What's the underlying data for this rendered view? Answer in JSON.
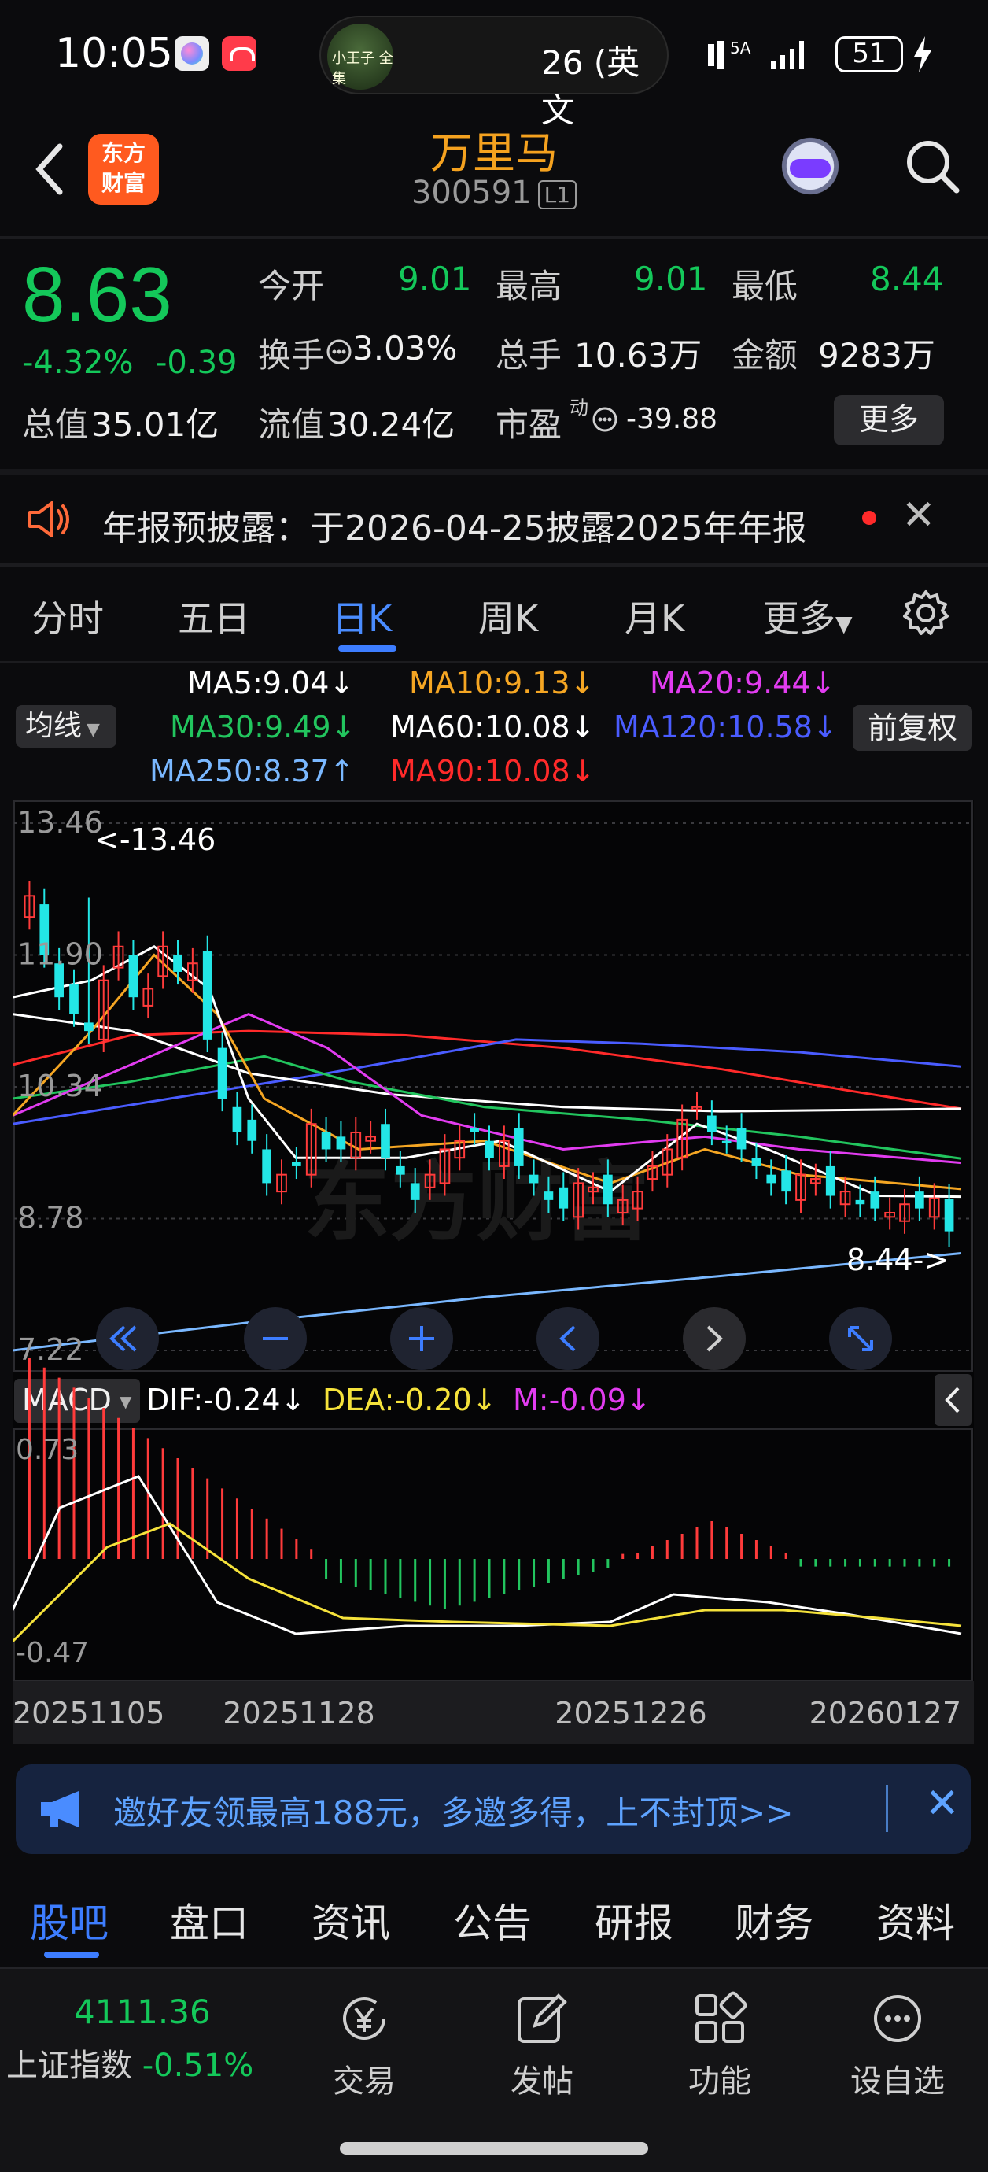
{
  "status_bar": {
    "time": "10:05",
    "island_text": "26 (英文",
    "island_thumb": "小王子 全集",
    "signal": "5A",
    "battery": "51"
  },
  "header": {
    "name": "万里马",
    "code": "300591",
    "badge": "L1",
    "logo": "东方\n财富"
  },
  "quote": {
    "price": "8.63",
    "change_pct": "-4.32%",
    "change": "-0.39",
    "open_label": "今开",
    "open": "9.01",
    "high_label": "最高",
    "high": "9.01",
    "low_label": "最低",
    "low": "8.44",
    "turnover_label": "换手",
    "turnover": "3.03%",
    "volume_label": "总手",
    "volume": "10.63万",
    "amount_label": "金额",
    "amount": "9283万",
    "mktcap_label": "总值",
    "mktcap": "35.01亿",
    "float_label": "流值",
    "float": "30.24亿",
    "pe_label": "市盈",
    "pe_sup": "动",
    "pe": "-39.88",
    "more": "更多"
  },
  "notice": {
    "text": "年报预披露：于2026-04-25披露2025年年报"
  },
  "chart_tabs": [
    "分时",
    "五日",
    "日K",
    "周K",
    "月K",
    "更多"
  ],
  "ma_legend": {
    "selector": "均线",
    "ma5": "MA5:9.04↓",
    "ma10": "MA10:9.13↓",
    "ma20": "MA20:9.44↓",
    "ma30": "MA30:9.49↓",
    "ma60": "MA60:10.08↓",
    "ma120": "MA120:10.58↓",
    "ma250": "MA250:8.37↑",
    "ma90": "MA90:10.08↓",
    "adjust": "前复权"
  },
  "chart_data": {
    "type": "candlestick",
    "price_axis": [
      "13.46",
      "11.90",
      "10.34",
      "8.78",
      "7.22"
    ],
    "high_marker": "<-13.46",
    "low_marker": "8.44->",
    "date_labels": [
      "20251105",
      "20251128",
      "20251226",
      "20260127"
    ],
    "macd": {
      "selector": "MACD",
      "dif": "DIF:-0.24↓",
      "dea": "DEA:-0.20↓",
      "m": "M:-0.09↓",
      "axis_top": "0.73",
      "axis_bottom": "-0.47"
    },
    "colors": {
      "up": "#ff3b3b",
      "down": "#23e6e6",
      "ma5": "#ffffff",
      "ma10": "#f5a623",
      "ma20": "#e23cf0",
      "ma30": "#22c55e",
      "ma60": "#ffffff",
      "ma120": "#4a5cff",
      "ma250": "#7ab8ff",
      "ma90": "#ff2a2a",
      "dif": "#ffffff",
      "dea": "#f5e23b"
    }
  },
  "banner": {
    "text": "邀好友领最高188元，多邀多得，上不封顶>>"
  },
  "section_tabs": [
    "股吧",
    "盘口",
    "资讯",
    "公告",
    "研报",
    "财务",
    "资料"
  ],
  "bottom": {
    "index_value": "4111.36",
    "index_name": "上证指数",
    "index_change": "-0.51%",
    "nav": [
      "交易",
      "发帖",
      "功能",
      "设自选"
    ]
  }
}
